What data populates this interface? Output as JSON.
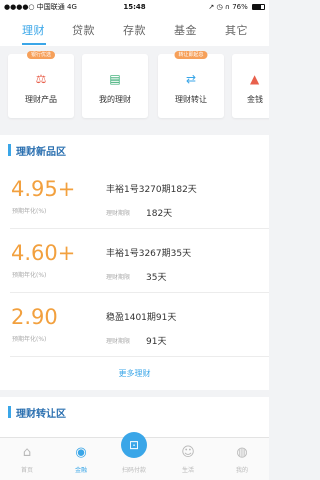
{
  "status_bar": {
    "carrier": "中国联通",
    "network": "4G",
    "time": "15:48",
    "battery_text": "76%",
    "battery_level": 0.76
  },
  "tabs": [
    {
      "label": "理财",
      "active": true
    },
    {
      "label": "贷款",
      "active": false
    },
    {
      "label": "存款",
      "active": false
    },
    {
      "label": "基金",
      "active": false
    },
    {
      "label": "其它",
      "active": false
    }
  ],
  "quick_entries": [
    {
      "badge": "银行优选",
      "icon": "dumbbell-icon",
      "label": "理财产品"
    },
    {
      "badge": "",
      "icon": "wallet-icon",
      "label": "我的理财"
    },
    {
      "badge": "转让即起息",
      "icon": "transfer-icon",
      "label": "理财转让"
    },
    {
      "badge": "",
      "icon": "gold-icon",
      "label": "金钱"
    }
  ],
  "new_products_section": {
    "title": "理财新品区",
    "products": [
      {
        "rate": "4.95+",
        "rate_label": "预期年化(%)",
        "name": "丰裕1号3270期182天",
        "term_label": "理财期限",
        "term": "182天"
      },
      {
        "rate": "4.60+",
        "rate_label": "预期年化(%)",
        "name": "丰裕1号3267期35天",
        "term_label": "理财期限",
        "term": "35天"
      },
      {
        "rate": "2.90",
        "rate_label": "预期年化(%)",
        "name": "稳盈1401期91天",
        "term_label": "理财期限",
        "term": "91天"
      }
    ],
    "more_label": "更多理财"
  },
  "transfer_section": {
    "title": "理财转让区"
  },
  "bottom_nav": [
    {
      "label": "首页",
      "icon": "home-icon",
      "active": false
    },
    {
      "label": "金融",
      "icon": "piggy-bank-icon",
      "active": true
    },
    {
      "label": "扫码付款",
      "icon": "scan-pay-icon",
      "active": false
    },
    {
      "label": "生活",
      "icon": "life-icon",
      "active": false
    },
    {
      "label": "我的",
      "icon": "user-icon",
      "active": false
    }
  ],
  "colors": {
    "accent": "#3aa6e8",
    "rate": "#f2a03e",
    "badge": "#f6a05a"
  }
}
